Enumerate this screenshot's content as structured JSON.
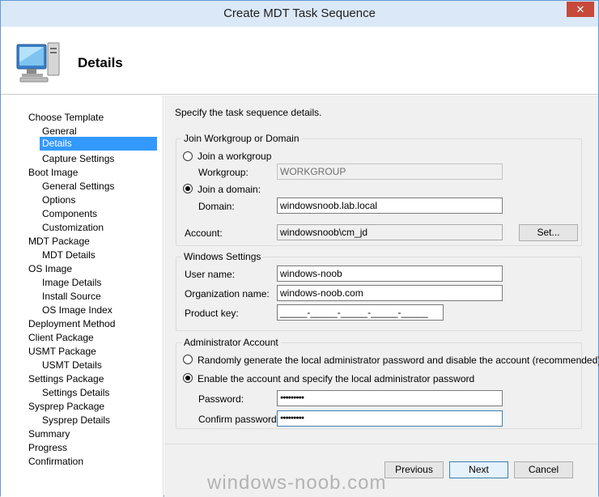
{
  "window": {
    "title": "Create MDT Task Sequence",
    "close_glyph": "✕"
  },
  "header": {
    "title": "Details",
    "icon": "computer-icon"
  },
  "nav": {
    "items": [
      {
        "label": "Choose Template",
        "level": 0
      },
      {
        "label": "General",
        "level": 1
      },
      {
        "label": "Details",
        "level": 1,
        "selected": true
      },
      {
        "label": "Capture Settings",
        "level": 1
      },
      {
        "label": "Boot Image",
        "level": 0
      },
      {
        "label": "General Settings",
        "level": 1
      },
      {
        "label": "Options",
        "level": 1
      },
      {
        "label": "Components",
        "level": 1
      },
      {
        "label": "Customization",
        "level": 1
      },
      {
        "label": "MDT Package",
        "level": 0
      },
      {
        "label": "MDT Details",
        "level": 1
      },
      {
        "label": "OS Image",
        "level": 0
      },
      {
        "label": "Image Details",
        "level": 1
      },
      {
        "label": "Install Source",
        "level": 1
      },
      {
        "label": "OS Image Index",
        "level": 1
      },
      {
        "label": "Deployment Method",
        "level": 0
      },
      {
        "label": "Client Package",
        "level": 0
      },
      {
        "label": "USMT Package",
        "level": 0
      },
      {
        "label": "USMT Details",
        "level": 1
      },
      {
        "label": "Settings Package",
        "level": 0
      },
      {
        "label": "Settings Details",
        "level": 1
      },
      {
        "label": "Sysprep Package",
        "level": 0
      },
      {
        "label": "Sysprep Details",
        "level": 1
      },
      {
        "label": "Summary",
        "level": 0
      },
      {
        "label": "Progress",
        "level": 0
      },
      {
        "label": "Confirmation",
        "level": 0
      }
    ]
  },
  "content": {
    "instruction": "Specify the task sequence details.",
    "join_group": {
      "title": "Join Workgroup or Domain",
      "workgroup_radio": "Join a workgroup",
      "workgroup_label": "Workgroup:",
      "workgroup_value": "WORKGROUP",
      "domain_radio": "Join a domain:",
      "domain_label": "Domain:",
      "domain_value": "windowsnoob.lab.local",
      "account_label": "Account:",
      "account_value": "windowsnoob\\cm_jd",
      "set_button": "Set..."
    },
    "windows_settings": {
      "title": "Windows Settings",
      "user_name_label": "User name:",
      "user_name_value": "windows-noob",
      "org_label": "Organization name:",
      "org_value": "windows-noob.com",
      "product_key_label": "Product key:",
      "product_key_value": "_____-_____-_____-_____-_____"
    },
    "admin_account": {
      "title": "Administrator Account",
      "random_radio": "Randomly generate the local administrator password and disable the account (recommended)",
      "enable_radio": "Enable the account and specify the local administrator password",
      "password_label": "Password:",
      "password_value": "●●●●●●●●●",
      "confirm_label": "Confirm password:",
      "confirm_value": "●●●●●●●●●"
    }
  },
  "footer": {
    "previous": "Previous",
    "next": "Next",
    "cancel": "Cancel"
  },
  "watermark": "windows-noob.com"
}
